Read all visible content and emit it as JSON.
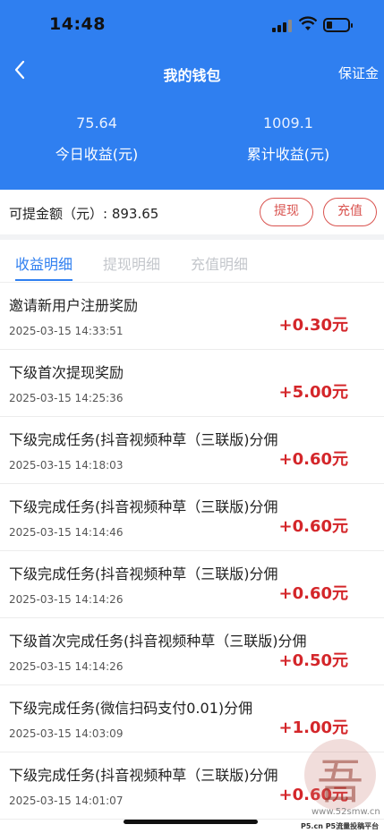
{
  "status": {
    "time": "14:48"
  },
  "nav": {
    "title": "我的钱包",
    "right_link": "保证金"
  },
  "stats": {
    "today_value": "75.64",
    "today_label": "今日收益(元)",
    "total_value": "1009.1",
    "total_label": "累计收益(元)"
  },
  "wallet": {
    "withdrawable": "可提金额（元）: 893.65",
    "withdraw_label": "提现",
    "recharge_label": "充值"
  },
  "tabs": [
    "收益明细",
    "提现明细",
    "充值明细"
  ],
  "records": [
    {
      "title": "邀请新用户注册奖励",
      "time": "2025-03-15 14:33:51",
      "amount": "+0.30元"
    },
    {
      "title": "下级首次提现奖励",
      "time": "2025-03-15 14:25:36",
      "amount": "+5.00元"
    },
    {
      "title": "下级完成任务(抖音视频种草（三联版)分佣",
      "time": "2025-03-15 14:18:03",
      "amount": "+0.60元"
    },
    {
      "title": "下级完成任务(抖音视频种草（三联版)分佣",
      "time": "2025-03-15 14:14:46",
      "amount": "+0.60元"
    },
    {
      "title": "下级完成任务(抖音视频种草（三联版)分佣",
      "time": "2025-03-15 14:14:26",
      "amount": "+0.60元"
    },
    {
      "title": "下级首次完成任务(抖音视频种草（三联版)分佣",
      "time": "2025-03-15 14:14:26",
      "amount": "+0.50元"
    },
    {
      "title": "下级完成任务(微信扫码支付0.01)分佣",
      "time": "2025-03-15 14:03:09",
      "amount": "+1.00元"
    },
    {
      "title": "下级完成任务(抖音视频种草（三联版)分佣",
      "time": "2025-03-15 14:01:07",
      "amount": "+0.60元"
    }
  ],
  "watermark": {
    "url": "www.52smw.cn",
    "footer": "P5.cn P5流量投稿平台"
  }
}
